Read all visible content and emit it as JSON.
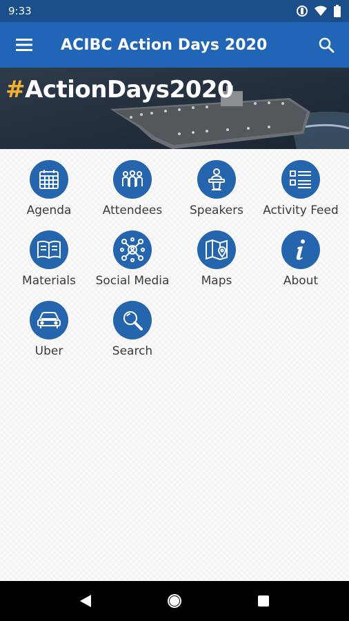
{
  "status_bar": {
    "time": "9:33"
  },
  "app_bar": {
    "title": "ACIBC Action Days 2020"
  },
  "banner": {
    "hash": "#",
    "hashtag": "ActionDays2020"
  },
  "tiles": [
    {
      "label": "Agenda",
      "icon": "calendar-icon"
    },
    {
      "label": "Attendees",
      "icon": "people-icon"
    },
    {
      "label": "Speakers",
      "icon": "podium-icon"
    },
    {
      "label": "Activity Feed",
      "icon": "list-icon"
    },
    {
      "label": "Materials",
      "icon": "book-icon"
    },
    {
      "label": "Social Media",
      "icon": "network-icon"
    },
    {
      "label": "Maps",
      "icon": "map-icon"
    },
    {
      "label": "About",
      "icon": "info-icon"
    },
    {
      "label": "Uber",
      "icon": "car-icon"
    },
    {
      "label": "Search",
      "icon": "search-icon"
    }
  ],
  "colors": {
    "status_bar": "#1a4e8a",
    "app_bar": "#2065b6",
    "tile_circle": "#2565ad",
    "hashtag_hash": "#f2b233"
  }
}
